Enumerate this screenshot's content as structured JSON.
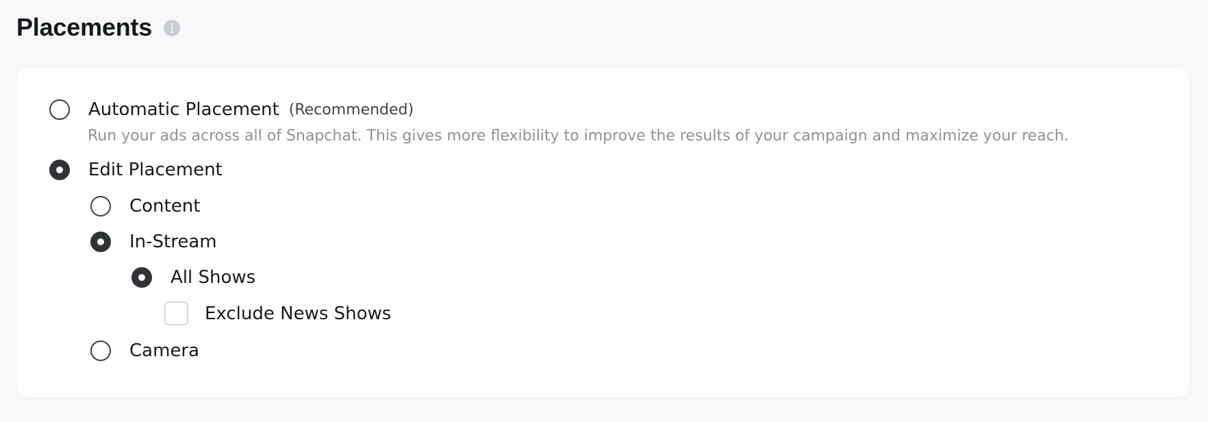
{
  "section": {
    "title": "Placements",
    "info_icon": "info-icon"
  },
  "placements": {
    "automatic": {
      "label": "Automatic Placement",
      "hint": "(Recommended)",
      "description": "Run your ads across all of Snapchat. This gives more flexibility to improve the results of your campaign and maximize your reach.",
      "selected": false
    },
    "edit": {
      "label": "Edit Placement",
      "selected": true
    },
    "content": {
      "label": "Content",
      "selected": false
    },
    "in_stream": {
      "label": "In-Stream",
      "selected": true
    },
    "all_shows": {
      "label": "All Shows",
      "selected": true
    },
    "exclude_news": {
      "label": "Exclude News Shows",
      "checked": false
    },
    "camera": {
      "label": "Camera",
      "selected": false
    }
  },
  "colors": {
    "page_background": "#f6f7f9",
    "card_background": "#ffffff",
    "text_primary": "#16191c",
    "text_secondary": "#8d9297",
    "radio_selected": "#2f3236"
  }
}
